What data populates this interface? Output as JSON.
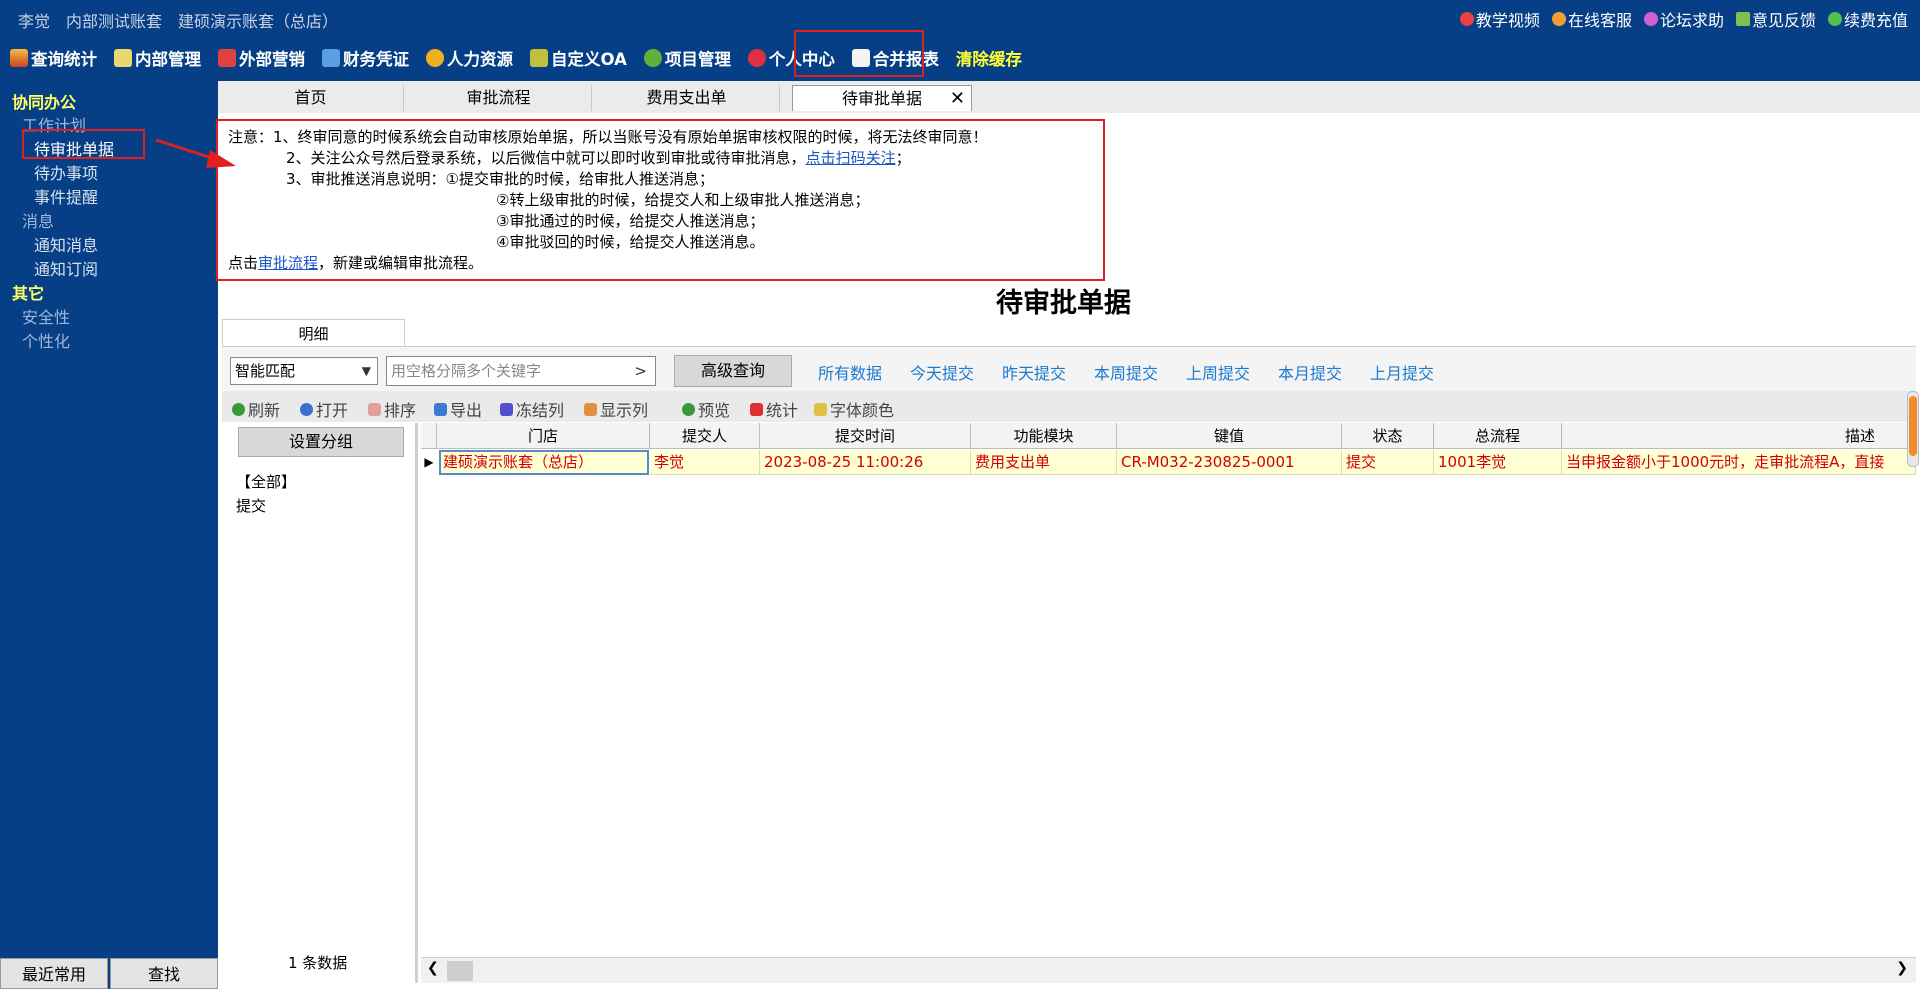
{
  "header": {
    "user": "李觉",
    "account_type": "内部测试账套",
    "account_name": "建硕演示账套（总店）",
    "links": [
      "教学视频",
      "在线客服",
      "论坛求助",
      "意见反馈",
      "续费充值"
    ],
    "menu": [
      "查询统计",
      "内部管理",
      "外部营销",
      "财务凭证",
      "人力资源",
      "自定义OA",
      "项目管理",
      "个人中心",
      "合并报表",
      "清除缓存"
    ]
  },
  "sidebar": {
    "group1": "协同办公",
    "work_plan": "工作计划",
    "pending_docs": "待审批单据",
    "todo": "待办事项",
    "event_reminder": "事件提醒",
    "message": "消息",
    "notice_msg": "通知消息",
    "notice_sub": "通知订阅",
    "group2": "其它",
    "security": "安全性",
    "personalize": "个性化",
    "recent": "最近常用",
    "find": "查找"
  },
  "tabs": [
    "首页",
    "审批流程",
    "费用支出单",
    "待审批单据"
  ],
  "tab_close": "✕",
  "notice": {
    "line1": "注意：1、终审同意的时候系统会自动审核原始单据，所以当账号没有原始单据审核权限的时候，将无法终审同意！",
    "line2_pre": "2、关注公众号然后登录系统，以后微信中就可以即时收到审批或待审批消息，",
    "line2_link": "点击扫码关注",
    "line2_post": "；",
    "line3": "3、审批推送消息说明：①提交审批的时候，给审批人推送消息；",
    "line4": "②转上级审批的时候，给提交人和上级审批人推送消息；",
    "line5": "③审批通过的时候，给提交人推送消息；",
    "line6": "④审批驳回的时候，给提交人推送消息。",
    "line7_pre": "点击",
    "line7_link": "审批流程",
    "line7_post": "，新建或编辑审批流程。"
  },
  "page_title": "待审批单据",
  "detail_tab": "明细",
  "filter": {
    "match_mode": "智能匹配",
    "search_placeholder": "用空格分隔多个关键字",
    "search_go": ">",
    "advanced": "高级查询",
    "quick": [
      "所有数据",
      "今天提交",
      "昨天提交",
      "本周提交",
      "上周提交",
      "本月提交",
      "上月提交"
    ]
  },
  "toolbar": [
    "刷新",
    "打开",
    "排序",
    "导出",
    "冻结列",
    "显示列",
    "预览",
    "统计",
    "字体颜色"
  ],
  "left_panel": {
    "set_group": "设置分组",
    "all": "【全部】",
    "submit": "提交",
    "count": "1 条数据"
  },
  "table": {
    "columns": [
      "门店",
      "提交人",
      "提交时间",
      "功能模块",
      "键值",
      "状态",
      "总流程",
      "描述"
    ],
    "rows": [
      [
        "建硕演示账套（总店）",
        "李觉",
        "2023-08-25 11:00:26",
        "费用支出单",
        "CR-M032-230825-0001",
        "提交",
        "1001李觉",
        "当申报金额小于1000元时，走审批流程A，直接"
      ]
    ]
  },
  "colors": {
    "header_bg": "#063f86",
    "highlight_red": "#e02020",
    "row_bg": "#ffffd4",
    "row_text": "#d40000",
    "link_blue": "#1b7bcf"
  }
}
